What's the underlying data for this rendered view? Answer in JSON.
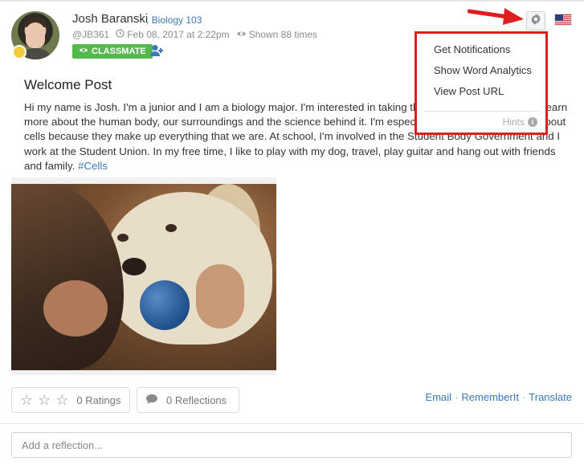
{
  "post": {
    "author": "Josh Baranski",
    "course": ", Biology 103",
    "handle": "@JB361",
    "date": "Feb 08, 2017 at 2:22pm",
    "views": "Shown 88 times",
    "badge": "CLASSMATE",
    "title": "Welcome Post",
    "body": "Hi my name is Josh. I'm a junior and I am a biology major. I'm interested in taking this class because I want to learn more about the human body, our surroundings and the science behind it. I'm especially interested in learning about cells because they make up everything that we are. At school, I'm involved in the Student Body Government and I work at the Student Union. In my free time, I like to play with my dog, travel, play guitar and hang out with friends and family.",
    "hashtag": "#Cells"
  },
  "menu": {
    "items": [
      "Get Notifications",
      "Show Word Analytics",
      "View Post URL"
    ],
    "hints": "Hints"
  },
  "footer": {
    "ratings": "0 Ratings",
    "reflections": "0 Reflections",
    "links": [
      "Email",
      "RememberIt",
      "Translate"
    ]
  },
  "reflection": {
    "placeholder": "Add a reflection..."
  },
  "colors": {
    "accent": "#3b78b5",
    "badge": "#55b94d",
    "highlight": "#e01e1e",
    "status": "#f4cc3b"
  },
  "icons": [
    "clock-icon",
    "eye-icon",
    "add-friend-icon",
    "gear-icon",
    "us-flag-icon",
    "star-icon",
    "comment-icon",
    "info-icon",
    "red-arrow-icon"
  ]
}
